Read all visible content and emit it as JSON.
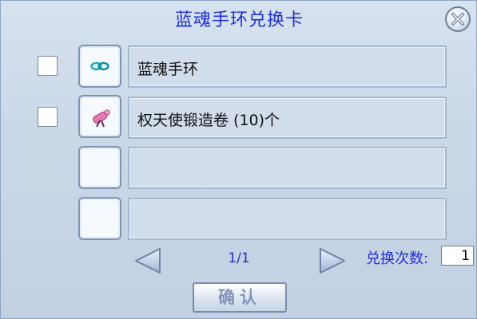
{
  "dialog": {
    "title": "蓝魂手环兑换卡",
    "close_icon": "close-icon"
  },
  "items": [
    {
      "checked": false,
      "icon": "bracelet-icon",
      "name": "蓝魂手环"
    },
    {
      "checked": false,
      "icon": "scroll-icon",
      "name": "权天使锻造卷 (10)个"
    },
    {
      "checked": false,
      "icon": "",
      "name": ""
    },
    {
      "checked": false,
      "icon": "",
      "name": ""
    }
  ],
  "pagination": {
    "prev_icon": "arrow-left-icon",
    "next_icon": "arrow-right-icon",
    "page": "1/1"
  },
  "exchange": {
    "count_label": "兑换次数:",
    "count_value": "1"
  },
  "confirm_label": "确认",
  "colors": {
    "title_blue": "#1f2fd6",
    "panel_bg": "#cbd8e8",
    "bracelet_cyan": "#15b3c2",
    "scroll_pink": "#e57bb2"
  }
}
